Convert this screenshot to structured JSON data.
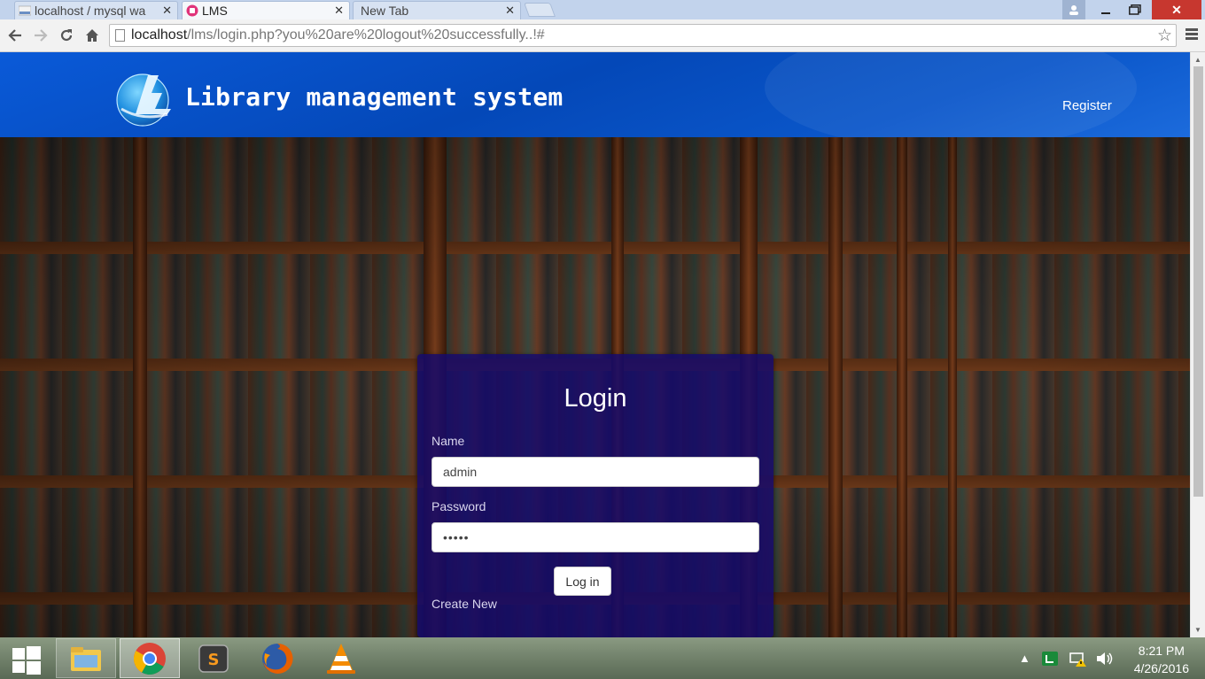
{
  "browser": {
    "tabs": [
      {
        "label": "localhost / mysql wa",
        "state": "inactive"
      },
      {
        "label": "LMS",
        "state": "active"
      },
      {
        "label": "New Tab",
        "state": "inactive"
      }
    ],
    "url_host": "localhost",
    "url_path": "/lms/login.php?you%20are%20logout%20successfully..!#"
  },
  "site": {
    "title": "Library management system",
    "register_label": "Register"
  },
  "login": {
    "heading": "Login",
    "name_label": "Name",
    "name_value": "admin",
    "password_label": "Password",
    "password_value": "•••••",
    "submit_label": "Log in",
    "create_label": "Create New"
  },
  "taskbar": {
    "time": "8:21 PM",
    "date": "4/26/2016"
  },
  "colors": {
    "header_blue": "#0448b8",
    "panel_bg": "#14086e",
    "tab_strip": "#c2d3ec"
  }
}
